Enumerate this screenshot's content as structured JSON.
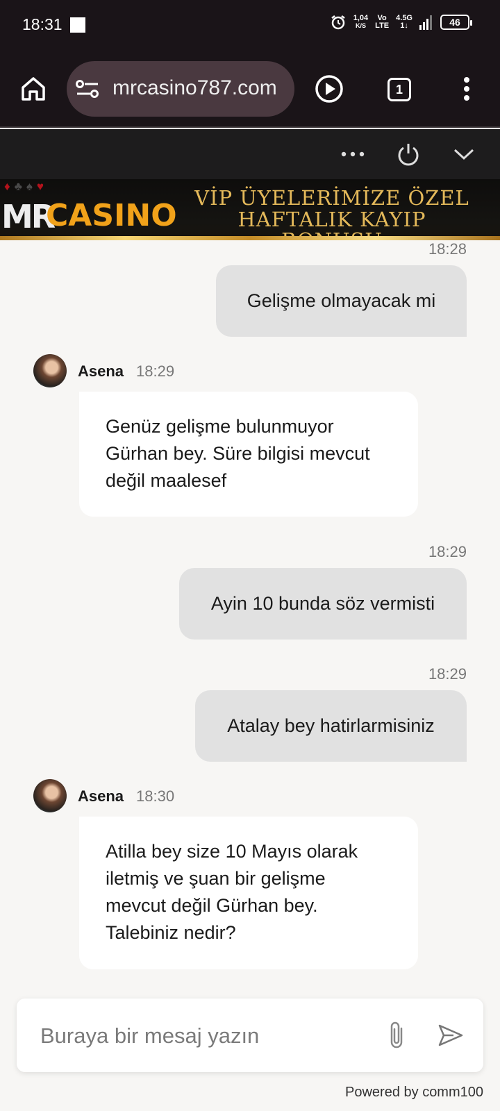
{
  "status_bar": {
    "time": "18:31",
    "net_speed_value": "1,04",
    "net_speed_unit": "K/S",
    "volte_top": "Vo",
    "volte_bottom": "LTE",
    "network_top": "4.5G",
    "network_bottom": "1↓",
    "battery": "46"
  },
  "browser": {
    "url": "mrcasino787.com",
    "tab_count": "1"
  },
  "banner": {
    "logo_mr": "MR",
    "logo_casino": "CASINO",
    "headline_line1": "VİP ÜYELERİMİZE ÖZEL",
    "headline_line2": "HAFTALIK KAYIP BONUSU"
  },
  "chat": {
    "messages": [
      {
        "from": "user",
        "time": "18:28",
        "text": "Gelişme olmayacak mi"
      },
      {
        "from": "agent",
        "name": "Asena",
        "time": "18:29",
        "lines": [
          "Genüz gelişme bulunmuyor",
          "Gürhan bey. Süre bilgisi mevcut",
          "değil maalesef"
        ]
      },
      {
        "from": "user",
        "time": "18:29",
        "text": "Ayin 10 bunda söz vermisti"
      },
      {
        "from": "user",
        "time": "18:29",
        "text": "Atalay bey hatirlarmisiniz"
      },
      {
        "from": "agent",
        "name": "Asena",
        "time": "18:30",
        "lines": [
          "Atilla bey size 10 Mayıs olarak",
          "iletmiş ve şuan bir gelişme",
          "mevcut değil Gürhan bey.",
          "Talebiniz nedir?"
        ]
      }
    ],
    "input_placeholder": "Buraya bir mesaj yazın",
    "powered_by": "Powered by comm100"
  },
  "colors": {
    "bar_bg": "#1a1418",
    "url_pill": "#4a3940",
    "user_bubble": "#e1e1e1",
    "agent_bubble": "#ffffff",
    "chat_bg": "#f7f6f4",
    "brand_gold": "#f1a21a"
  },
  "icons": [
    "home-icon",
    "site-settings-icon",
    "play-icon",
    "tabs-icon",
    "menu-icon",
    "more-options-icon",
    "power-icon",
    "chevron-down-icon",
    "attach-icon",
    "send-icon"
  ]
}
